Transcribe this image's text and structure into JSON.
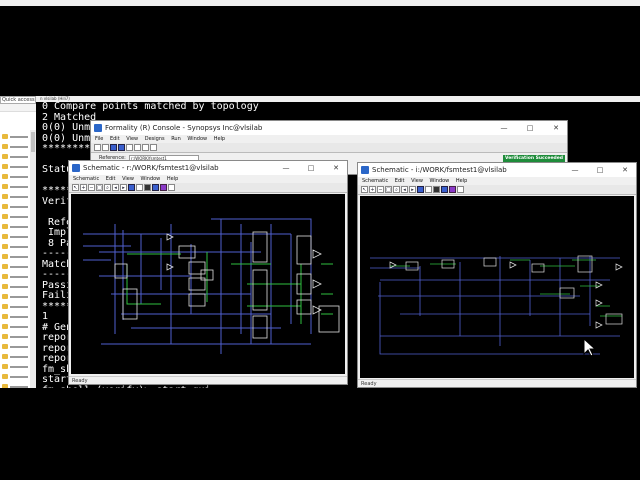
{
  "taskbar": {
    "quick_access": "Quick access"
  },
  "vlsi_window": {
    "title": "n vlsilab (Hili7)"
  },
  "terminal": {
    "lines": [
      "0 Compare points matched by topology",
      "2 Matched",
      "0(0) Unma",
      "0(0) Unma",
      "*********",
      "",
      "Status",
      "",
      "*********",
      "Verifi",
      "",
      " Refer",
      " Imple",
      " 8 Pas",
      "-------",
      "Matche",
      "-------",
      "Passin",
      "Failin",
      "*******",
      "1",
      "# Gene",
      "report",
      "report",
      "report",
      "fm_she",
      "start_",
      "fm shell (verify)> start gui"
    ]
  },
  "console": {
    "title": "Formality (R) Console - Synopsys Inc@vlsilab",
    "menu": [
      "File",
      "Edit",
      "View",
      "Designs",
      "Run",
      "Window",
      "Help"
    ],
    "reference_label": "Reference:",
    "reference_value": "r:/WORK/fsmtest1",
    "status": "Verification Succeeded",
    "status_color": "#1e8c3a",
    "controls": [
      "—",
      "□",
      "✕"
    ]
  },
  "schematic_left": {
    "title": "Schematic - r:/WORK/fsmtest1@vlsilab",
    "menu": [
      "Schematic",
      "Edit",
      "View",
      "Window",
      "Help"
    ],
    "status": "Ready",
    "controls": [
      "—",
      "□",
      "✕"
    ]
  },
  "schematic_right": {
    "title": "Schematic - i:/WORK/fsmtest1@vlsilab",
    "menu": [
      "Schematic",
      "Edit",
      "View",
      "Window",
      "Help"
    ],
    "status": "Ready",
    "controls": [
      "—",
      "□",
      "✕"
    ]
  },
  "colors": {
    "wire_blue": "#5060d0",
    "wire_green": "#30c040",
    "cell_outline": "#e0e0e0"
  }
}
